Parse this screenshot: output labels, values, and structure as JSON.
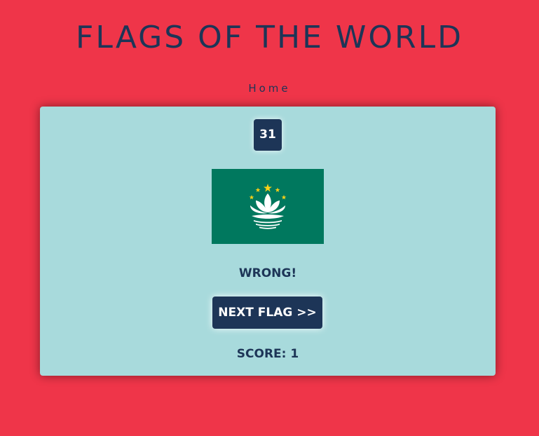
{
  "header": {
    "title": "FLAGS OF THE WORLD",
    "nav_home": "Home"
  },
  "quiz": {
    "counter": "31",
    "flag_icon": "macau-flag-icon",
    "result": "WRONG!",
    "next_button_label": "NEXT FLAG >>",
    "score_label": "SCORE: 1"
  },
  "colors": {
    "background": "#ef3549",
    "card": "#a8dadc",
    "primary_dark": "#1d3557",
    "flag_green": "#00785e",
    "flag_star": "#fbd116"
  }
}
